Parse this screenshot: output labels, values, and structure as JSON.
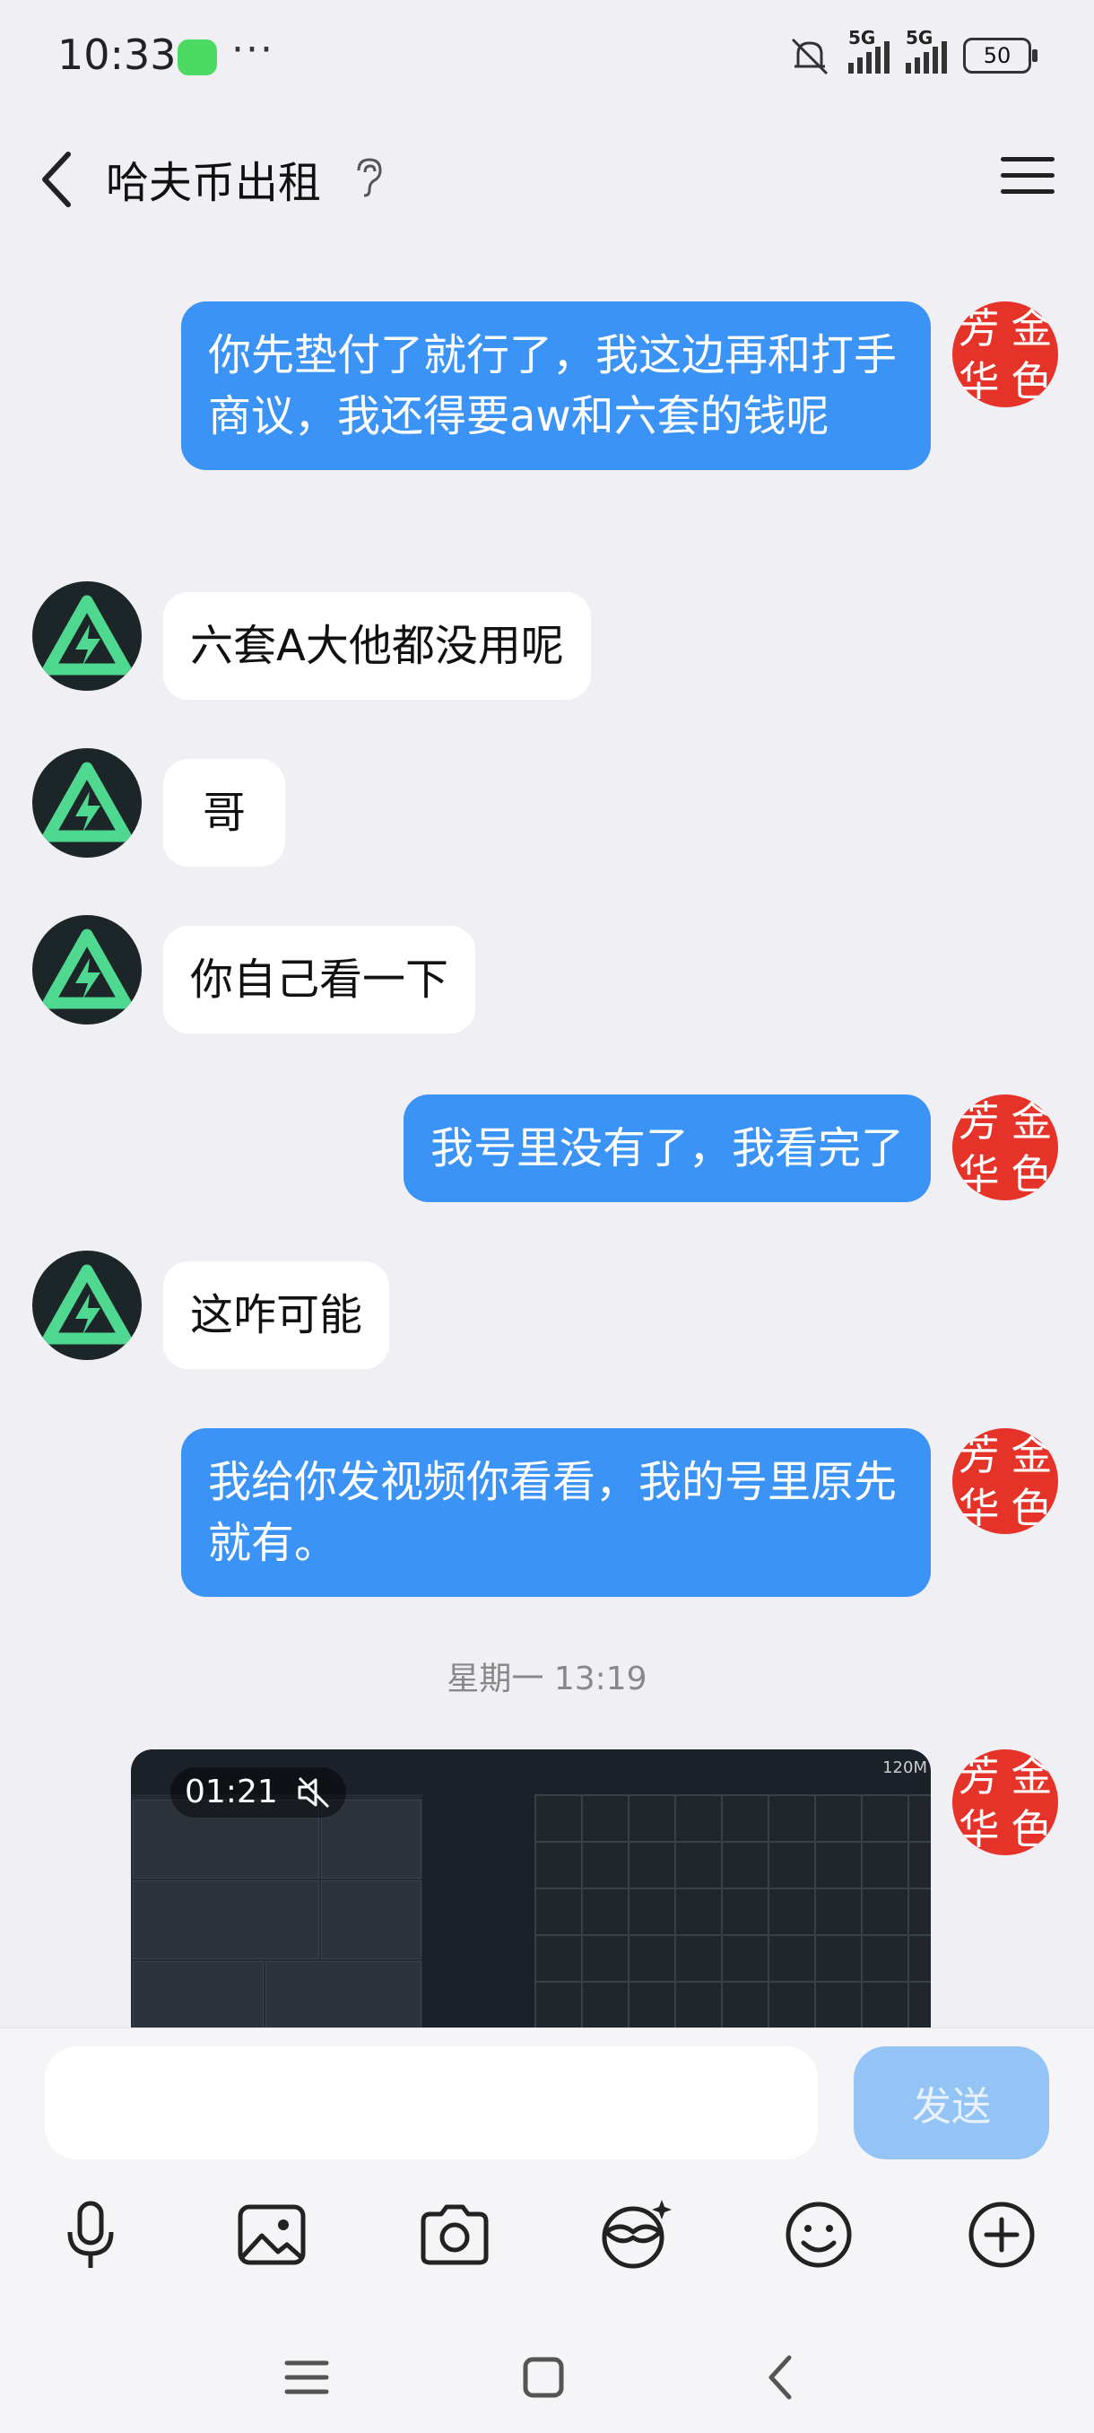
{
  "status_bar": {
    "time": "10:33",
    "more": "···",
    "signal1_label": "5G",
    "signal2_label": "5G",
    "battery": "50"
  },
  "header": {
    "title": "哈夫币出租"
  },
  "avatars": {
    "me_chars": [
      "芳",
      "金",
      "华",
      "色"
    ]
  },
  "messages": [
    {
      "side": "out",
      "text": "你先垫付了就行了，我这边再和打手商议，我还得要aw和六套的钱呢"
    },
    {
      "side": "in",
      "text": "六套A大他都没用呢"
    },
    {
      "side": "in",
      "text": "哥"
    },
    {
      "side": "in",
      "text": "你自己看一下"
    },
    {
      "side": "out",
      "text": "我号里没有了，我看完了"
    },
    {
      "side": "in",
      "text": "这咋可能"
    },
    {
      "side": "out",
      "text": "我给你发视频你看看，我的号里原先就有。"
    }
  ],
  "timestamp": "星期一 13:19",
  "video": {
    "duration": "01:21",
    "corner_tag": "120M"
  },
  "input": {
    "value": "",
    "send_label": "发送"
  },
  "toolbar_icons": [
    "mic-icon",
    "image-icon",
    "camera-icon",
    "face-mask-icon",
    "emoji-icon",
    "plus-icon"
  ],
  "nav_icons": [
    "menu-nav-icon",
    "home-nav-icon",
    "back-nav-icon"
  ]
}
